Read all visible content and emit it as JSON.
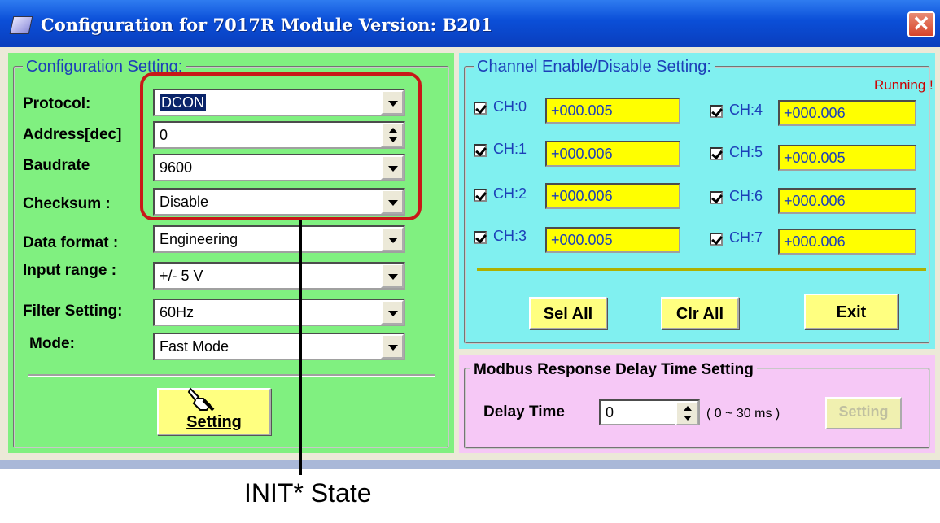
{
  "window": {
    "title": "Configuration for 7017R Module Version: B201",
    "close_icon": "close-icon",
    "title_color": "#0b4fd8"
  },
  "config_panel": {
    "legend": "Configuration Setting:",
    "color": "#80f080",
    "fields": {
      "protocol": {
        "label": "Protocol:",
        "value": "DCON"
      },
      "address": {
        "label": "Address[dec]",
        "value": "0"
      },
      "baudrate": {
        "label": "Baudrate",
        "value": "9600"
      },
      "checksum": {
        "label": "Checksum  :",
        "value": "Disable"
      },
      "data_format": {
        "label": "Data format :",
        "value": "Engineering"
      },
      "input_range": {
        "label": "Input range  :",
        "value": "+/- 5 V"
      },
      "filter": {
        "label": "Filter Setting:",
        "value": "60Hz"
      },
      "mode": {
        "label": "Mode:",
        "value": "Fast Mode"
      }
    },
    "setting_button_label": "Setting"
  },
  "channel_panel": {
    "legend": "Channel Enable/Disable Setting:",
    "status": "Running !",
    "color": "#80f0f0",
    "channels": [
      {
        "label": "CH:0",
        "value": "+000.005",
        "checked": true
      },
      {
        "label": "CH:1",
        "value": "+000.006",
        "checked": true
      },
      {
        "label": "CH:2",
        "value": "+000.006",
        "checked": true
      },
      {
        "label": "CH:3",
        "value": "+000.005",
        "checked": true
      },
      {
        "label": "CH:4",
        "value": "+000.006",
        "checked": true
      },
      {
        "label": "CH:5",
        "value": "+000.005",
        "checked": true
      },
      {
        "label": "CH:6",
        "value": "+000.006",
        "checked": true
      },
      {
        "label": "CH:7",
        "value": "+000.006",
        "checked": true
      }
    ],
    "buttons": {
      "sel_all": "Sel All",
      "clr_all": "Clr All",
      "exit": "Exit"
    }
  },
  "modbus_panel": {
    "legend": "Modbus Response Delay Time Setting",
    "color": "#f6c8f6",
    "delay_label": "Delay Time",
    "delay_value": "0",
    "range_note": "( 0 ~ 30 ms )",
    "setting_button_label": "Setting"
  },
  "annotation": {
    "text": "INIT* State",
    "highlight_color": "#c81818"
  }
}
